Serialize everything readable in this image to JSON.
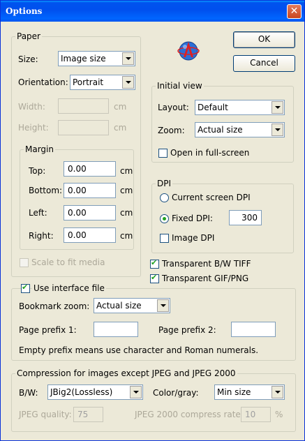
{
  "window": {
    "title": "Options",
    "close_symbol": "✕"
  },
  "buttons": {
    "ok": "OK",
    "cancel": "Cancel"
  },
  "paper": {
    "group_label": "Paper",
    "size_label": "Size:",
    "size_value": "Image size",
    "orientation_label": "Orientation:",
    "orientation_value": "Portrait",
    "width_label": "Width:",
    "width_unit": "cm",
    "height_label": "Height:",
    "height_unit": "cm",
    "margin": {
      "group_label": "Margin",
      "top_label": "Top:",
      "top_value": "0.00",
      "top_unit": "cm",
      "bottom_label": "Bottom:",
      "bottom_value": "0.00",
      "bottom_unit": "cm",
      "left_label": "Left:",
      "left_value": "0.00",
      "left_unit": "cm",
      "right_label": "Right:",
      "right_value": "0.00",
      "right_unit": "cm"
    },
    "scale_label": "Scale to fit media"
  },
  "initial_view": {
    "group_label": "Initial view",
    "layout_label": "Layout:",
    "layout_value": "Default",
    "zoom_label": "Zoom:",
    "zoom_value": "Actual size",
    "fullscreen_label": "Open in full-screen"
  },
  "dpi": {
    "group_label": "DPI",
    "current_label": "Current screen DPI",
    "fixed_label": "Fixed DPI:",
    "fixed_value": "300",
    "image_label": "Image DPI"
  },
  "transparent": {
    "bw_tiff_label": "Transparent B/W TIFF",
    "gif_png_label": "Transparent GIF/PNG"
  },
  "interface": {
    "group_label": "Use interface file",
    "bookmark_label": "Bookmark zoom:",
    "bookmark_value": "Actual size",
    "prefix1_label": "Page prefix 1:",
    "prefix1_value": "",
    "prefix2_label": "Page prefix 2:",
    "prefix2_value": "",
    "note": "Empty prefix means use character and Roman numerals."
  },
  "compression": {
    "group_label": "Compression for images except JPEG and JPEG 2000",
    "bw_label": "B/W:",
    "bw_value": "JBig2(Lossless)",
    "color_label": "Color/gray:",
    "color_value": "Min size",
    "jpeg_quality_label": "JPEG quality:",
    "jpeg_quality_value": "75",
    "jpeg2000_label": "JPEG 2000 compress rate:",
    "jpeg2000_value": "10",
    "jpeg2000_unit": "%"
  },
  "colors": {
    "titlebar": "#0054e3",
    "face": "#ece9d8",
    "check": "#21a121"
  },
  "icons": {
    "app_logo": "pdf-a-logo-icon"
  }
}
